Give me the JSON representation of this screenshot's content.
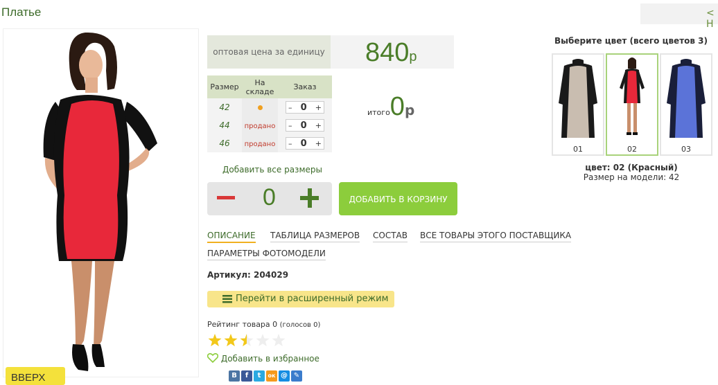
{
  "page": {
    "title": "Платье",
    "top_nav_glyph": "< Н"
  },
  "price": {
    "label": "оптовая цена за единицу",
    "value": "840",
    "currency": "р"
  },
  "stock_table": {
    "headers": [
      "Размер",
      "На складе",
      "Заказ"
    ],
    "rows": [
      {
        "size": "42",
        "status": "",
        "status_type": "in-stock",
        "qty": "0"
      },
      {
        "size": "44",
        "status": "продано",
        "status_type": "sold",
        "qty": "0"
      },
      {
        "size": "46",
        "status": "продано",
        "status_type": "sold",
        "qty": "0"
      }
    ],
    "minus": "–",
    "plus": "+"
  },
  "total": {
    "label": "итого",
    "value": "0",
    "currency": "р"
  },
  "add_all_sizes": "Добавить все размеры",
  "quantity": {
    "value": "0"
  },
  "cart_button": "ДОБАВИТЬ В КОРЗИНУ",
  "tabs": [
    {
      "label": "ОПИСАНИЕ",
      "active": true
    },
    {
      "label": "ТАБЛИЦА РАЗМЕРОВ",
      "active": false
    },
    {
      "label": "СОСТАВ",
      "active": false
    },
    {
      "label": "ВСЕ ТОВАРЫ ЭТОГО ПОСТАВЩИКА",
      "active": false
    },
    {
      "label": "ПАРАМЕТРЫ ФОТОМОДЕЛИ",
      "active": false
    }
  ],
  "article": "Артикул: 204029",
  "extended_mode": "Перейти в расширенный режим",
  "rating": {
    "label": "Рейтинг товара 0",
    "votes": "(голосов 0)",
    "stars_shown": 2.5,
    "stars_max": 5
  },
  "favorite": "Добавить в избранное",
  "social": [
    "В",
    "f",
    "t",
    "ок",
    "@",
    "✎"
  ],
  "back_to_top": "ВВЕРХ",
  "colors": {
    "title": "Выберите цвет (всего цветов 3)",
    "items": [
      {
        "num": "01",
        "body": "#c9bdb0",
        "side": "#1a1a1a"
      },
      {
        "num": "02",
        "body": "#e8283a",
        "side": "#1a1a1a"
      },
      {
        "num": "03",
        "body": "#5b73d8",
        "side": "#1a1f3a"
      }
    ],
    "selected": "цвет: 02 (Красный)",
    "model_size": "Размер на модели: 42"
  },
  "accent_colors": {
    "green": "#4a7d28",
    "cart": "#8ccd3c",
    "yellow": "#f4e13b",
    "red": "#d93838"
  }
}
